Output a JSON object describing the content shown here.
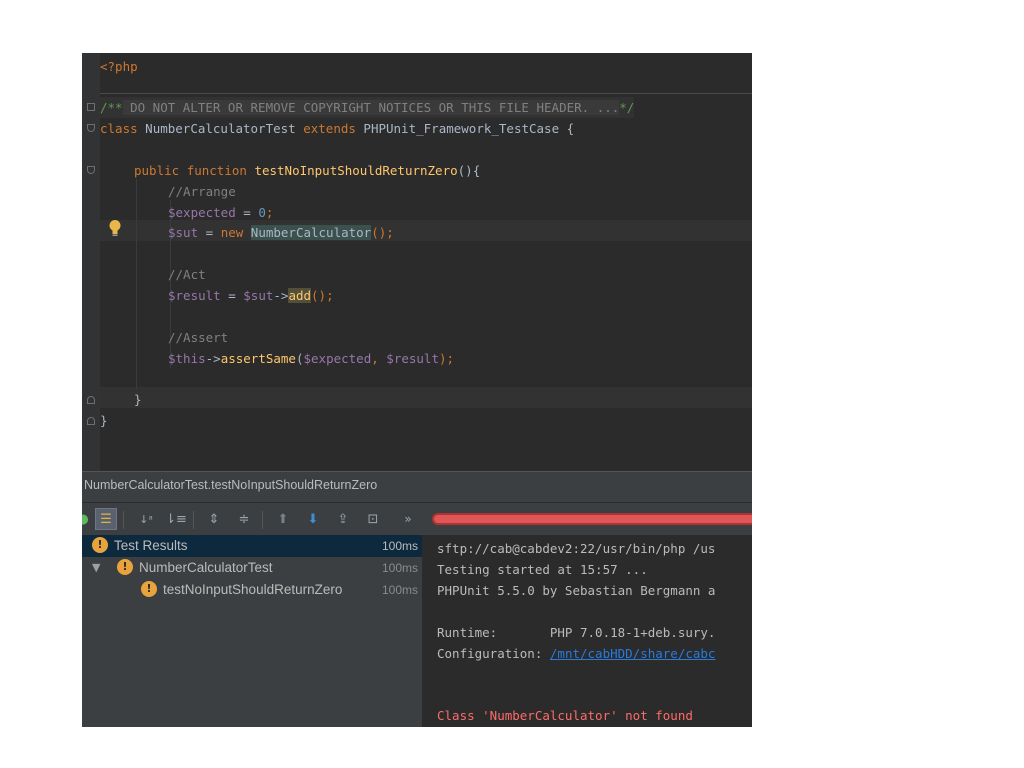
{
  "editor": {
    "line1": "<?php",
    "doc_open": "/**",
    "doc_text": " DO NOT ALTER OR REMOVE COPYRIGHT NOTICES OR THIS FILE HEADER. ...",
    "doc_close": "*/",
    "kw_class": "class",
    "class_name": " NumberCalculatorTest ",
    "kw_extends": "extends",
    "parent_class": " PHPUnit_Framework_TestCase {",
    "kw_public": "public",
    "kw_function": "function",
    "fn_name": "testNoInputShouldReturnZero",
    "fn_tail": "(){",
    "cmt_arrange": "//Arrange",
    "var_expected": "$expected",
    "assign_eq": " = ",
    "num_zero": "0",
    "semi": ";",
    "var_sut": "$sut",
    "kw_new": "new",
    "new_class": "NumberCalculator",
    "paren_semi": "();",
    "cmt_act": "//Act",
    "var_result": "$result",
    "arrow": "->",
    "method_add": "add",
    "cmt_assert": "//Assert",
    "var_this": "$this",
    "method_assert": "assertSame",
    "assert_args_open": "(",
    "comma": ", ",
    "assert_args_close": ");",
    "close_method": "}",
    "close_class": "}"
  },
  "run": {
    "title": "NumberCalculatorTest.testNoInputShouldReturnZero",
    "more": "»"
  },
  "tree": [
    {
      "label": "Test Results",
      "time": "100ms"
    },
    {
      "label": "NumberCalculatorTest",
      "time": "100ms"
    },
    {
      "label": "testNoInputShouldReturnZero",
      "time": "100ms"
    }
  ],
  "console": {
    "l1": "sftp://cab@cabdev2:22/usr/bin/php /us",
    "l2": "Testing started at 15:57 ...",
    "l3": "PHPUnit 5.5.0 by Sebastian Bergmann a",
    "l4_label": "Runtime:       PHP 7.0.18-1+deb.sury.",
    "l5_label": "Configuration: ",
    "l5_link": "/mnt/cabHDD/share/cabc",
    "l6": "Class 'NumberCalculator' not found"
  },
  "colors": {
    "keyword": "#cc7832",
    "function": "#ffc66d",
    "variable": "#9876aa",
    "number": "#6897bb",
    "comment": "#808080",
    "error": "#ff6b68",
    "warning": "#e8a33d"
  }
}
